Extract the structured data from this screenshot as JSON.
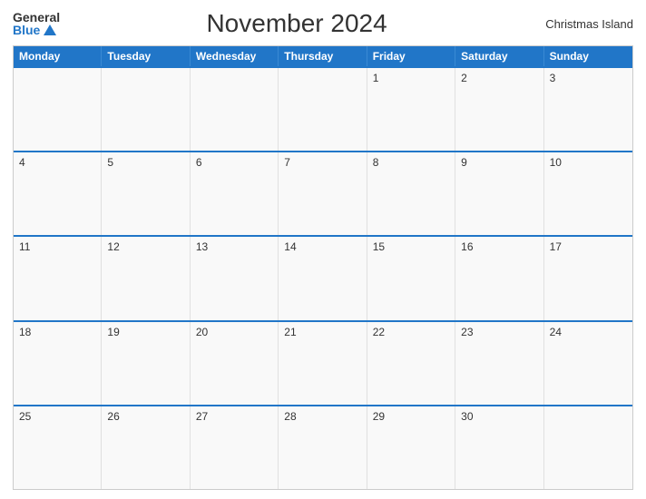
{
  "header": {
    "logo_general": "General",
    "logo_blue": "Blue",
    "title": "November 2024",
    "location": "Christmas Island"
  },
  "calendar": {
    "days_of_week": [
      "Monday",
      "Tuesday",
      "Wednesday",
      "Thursday",
      "Friday",
      "Saturday",
      "Sunday"
    ],
    "weeks": [
      [
        {
          "day": "",
          "empty": true
        },
        {
          "day": "",
          "empty": true
        },
        {
          "day": "",
          "empty": true
        },
        {
          "day": "",
          "empty": true
        },
        {
          "day": "1"
        },
        {
          "day": "2"
        },
        {
          "day": "3"
        }
      ],
      [
        {
          "day": "4"
        },
        {
          "day": "5"
        },
        {
          "day": "6"
        },
        {
          "day": "7"
        },
        {
          "day": "8"
        },
        {
          "day": "9"
        },
        {
          "day": "10"
        }
      ],
      [
        {
          "day": "11"
        },
        {
          "day": "12"
        },
        {
          "day": "13"
        },
        {
          "day": "14"
        },
        {
          "day": "15"
        },
        {
          "day": "16"
        },
        {
          "day": "17"
        }
      ],
      [
        {
          "day": "18"
        },
        {
          "day": "19"
        },
        {
          "day": "20"
        },
        {
          "day": "21"
        },
        {
          "day": "22"
        },
        {
          "day": "23"
        },
        {
          "day": "24"
        }
      ],
      [
        {
          "day": "25"
        },
        {
          "day": "26"
        },
        {
          "day": "27"
        },
        {
          "day": "28"
        },
        {
          "day": "29"
        },
        {
          "day": "30"
        },
        {
          "day": ""
        }
      ]
    ]
  }
}
